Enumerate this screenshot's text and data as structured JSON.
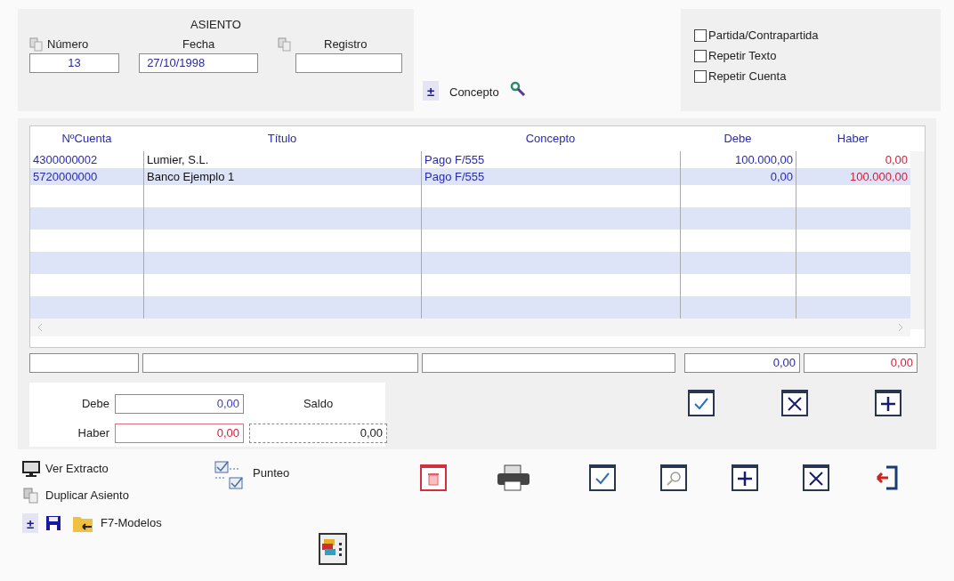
{
  "asiento": {
    "title": "ASIENTO",
    "numero": {
      "label": "Número",
      "value": "13"
    },
    "fecha": {
      "label": "Fecha",
      "value": "27/10/1998"
    },
    "registro": {
      "label": "Registro"
    }
  },
  "concepto": {
    "toggle": "±",
    "label": "Concepto"
  },
  "options": [
    {
      "label": "Partida/Contrapartida",
      "checked": false
    },
    {
      "label": "Repetir Texto",
      "checked": false
    },
    {
      "label": "Repetir Cuenta",
      "checked": false
    }
  ],
  "table": {
    "columns": [
      "NºCuenta",
      "Título",
      "Concepto",
      "Debe",
      "Haber"
    ],
    "rows": [
      {
        "cuenta": "4300000002",
        "titulo": "Lumier, S.L.",
        "concepto": "Pago F/555",
        "debe": "100.000,00",
        "haber": "0,00"
      },
      {
        "cuenta": "5720000000",
        "titulo": "Banco Ejemplo 1",
        "concepto": "Pago F/555",
        "debe": "0,00",
        "haber": "100.000,00"
      }
    ],
    "totals": {
      "debe": "0,00",
      "haber": "0,00"
    }
  },
  "summary": {
    "debe_label": "Debe",
    "debe": "0,00",
    "haber_label": "Haber",
    "haber": "0,00",
    "saldo_label": "Saldo",
    "saldo": "0,00"
  },
  "links": {
    "ver_extracto": "Ver Extracto",
    "duplicar": "Duplicar Asiento",
    "punteo": "Punteo",
    "toggle": "±",
    "modelos": "F7-Modelos"
  }
}
